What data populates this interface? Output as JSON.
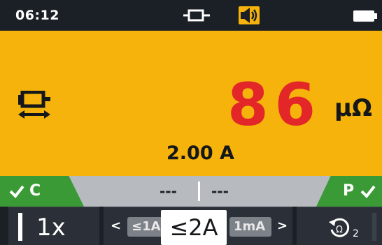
{
  "status_bar": {
    "time": "06:12",
    "icons": [
      "connector-icon",
      "speaker-icon",
      "battery-icon"
    ]
  },
  "reading": {
    "value": "86",
    "unit": "μΩ",
    "current": "2.00 A",
    "mode_icon": "bidirectional-lead-icon"
  },
  "result_strip": {
    "left_status": "C",
    "right_status": "P",
    "left_value": "---",
    "right_value": "---",
    "icon": "check-icon"
  },
  "softkeys": {
    "multiplier": {
      "label": "1x"
    },
    "current_select": {
      "left_option": "≤1A",
      "selected": "≤2A",
      "right_option": "1mA"
    },
    "reset": {
      "subscript": "2",
      "icon": "ohm-reset-icon"
    }
  },
  "colors": {
    "background": "#f5b30c",
    "reading": "#e32628",
    "pass": "#3a9a35",
    "bar": "#1b1f26"
  }
}
